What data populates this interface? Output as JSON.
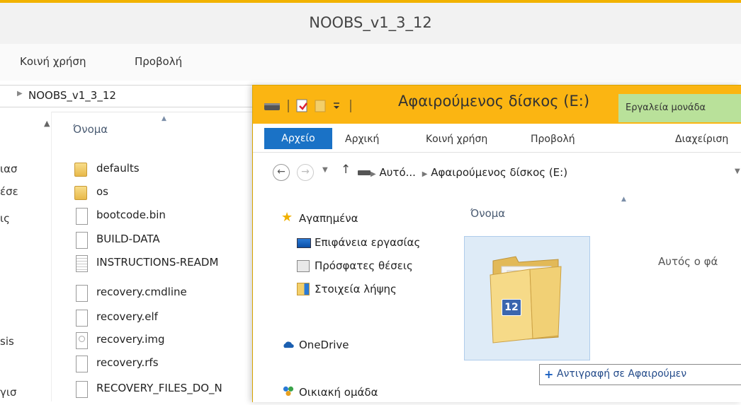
{
  "back_window": {
    "title": "NOOBS_v1_3_12",
    "ribbon_tabs": [
      "Κοινή χρήση",
      "Προβολή"
    ],
    "breadcrumb": "NOOBS_v1_3_12",
    "nav_fragments": [
      "ιασ",
      "έσε",
      "ις",
      "sis",
      "γισ"
    ],
    "column_header": "Όνομα",
    "files": [
      {
        "name": "defaults",
        "icon": "folder-icon"
      },
      {
        "name": "os",
        "icon": "folder-icon"
      },
      {
        "name": "bootcode.bin",
        "icon": "file-icon"
      },
      {
        "name": "BUILD-DATA",
        "icon": "file-icon"
      },
      {
        "name": "INSTRUCTIONS-READM",
        "icon": "text-file-icon"
      },
      {
        "name": "recovery.cmdline",
        "icon": "file-icon"
      },
      {
        "name": "recovery.elf",
        "icon": "file-icon"
      },
      {
        "name": "recovery.img",
        "icon": "disc-image-icon"
      },
      {
        "name": "recovery.rfs",
        "icon": "file-icon"
      },
      {
        "name": "RECOVERY_FILES_DO_N",
        "icon": "file-icon"
      }
    ]
  },
  "front_window": {
    "title": "Αφαιρούμενος δίσκος (E:)",
    "contextual_tab": "Εργαλεία μονάδα",
    "ribbon_tabs": {
      "file": "Αρχείο",
      "home": "Αρχική",
      "share": "Κοινή χρήση",
      "view": "Προβολή",
      "manage": "Διαχείριση"
    },
    "address_path": {
      "part1": "Αυτό...",
      "part2": "Αφαιρούμενος δίσκος (E:)"
    },
    "nav_items": {
      "favorites": "Αγαπημένα",
      "desktop": "Επιφάνεια εργασίας",
      "recent": "Πρόσφατες θέσεις",
      "downloads": "Στοιχεία λήψης",
      "onedrive": "OneDrive",
      "homegroup": "Οικιακή ομάδα"
    },
    "column_header": "Όνομα",
    "empty_message": "Αυτός ο φά",
    "drag": {
      "badge_count": "12",
      "tooltip_plus": "+",
      "tooltip_text": "Αντιγραφή σε Αφαιρούμεν"
    }
  },
  "colors": {
    "accent_yellow": "#fbb512",
    "file_tab_blue": "#1a72c6",
    "drive_tools_green": "#b9e19a"
  }
}
